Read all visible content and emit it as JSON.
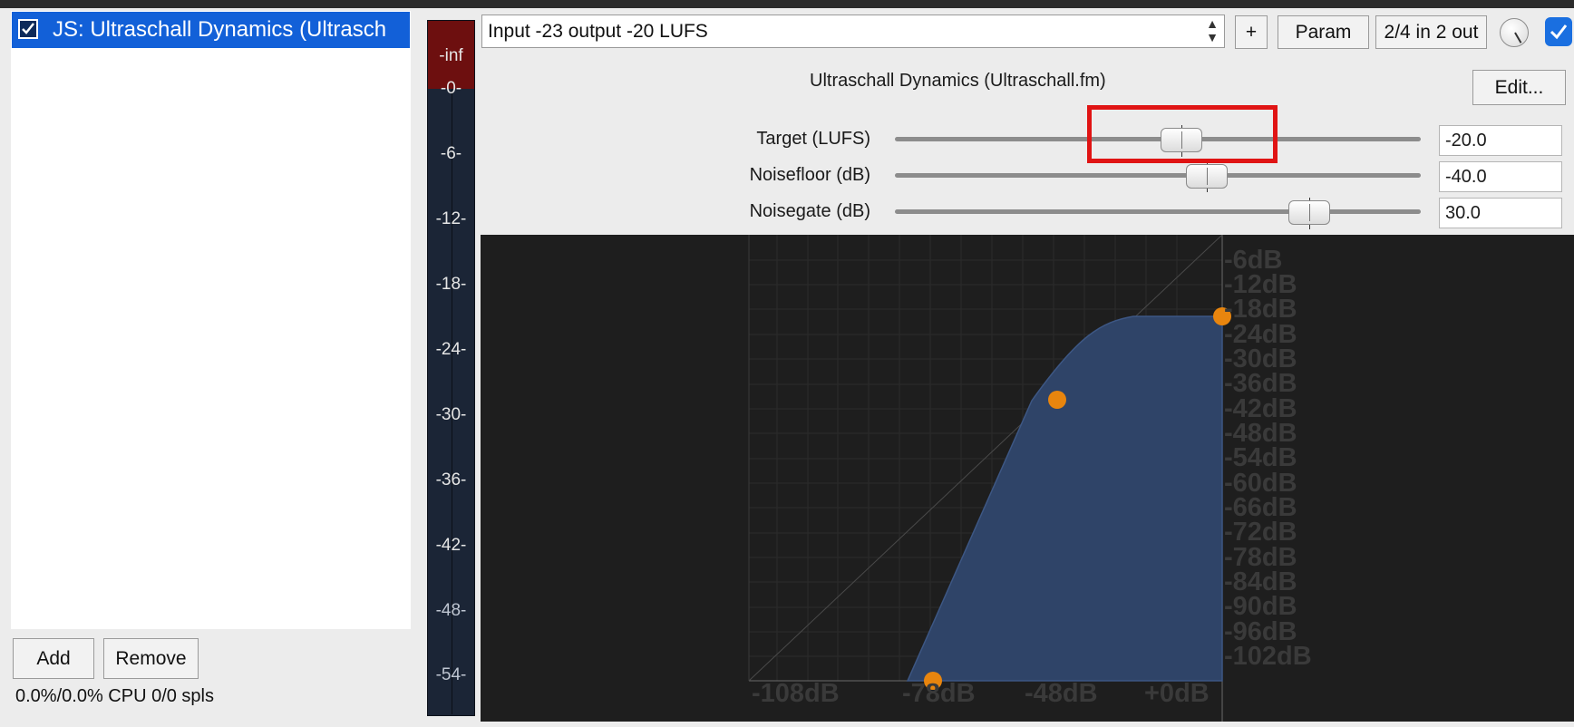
{
  "fx_list": {
    "items": [
      {
        "label": "JS: Ultraschall Dynamics (Ultrasch",
        "enabled": true
      }
    ]
  },
  "buttons": {
    "add": "Add",
    "remove": "Remove",
    "plus": "+",
    "param": "Param",
    "io": "2/4 in 2 out",
    "edit": "Edit..."
  },
  "status": "0.0%/0.0% CPU 0/0 spls",
  "meter": {
    "top": "-inf",
    "labels": [
      "-0-",
      "-6-",
      "-12-",
      "-18-",
      "-24-",
      "-30-",
      "-36-",
      "-42-",
      "-48-",
      "-54-"
    ]
  },
  "preset": {
    "value": "Input -23 output -20 LUFS"
  },
  "plugin": {
    "title": "Ultraschall Dynamics (Ultraschall.fm)",
    "sliders": [
      {
        "label": "Target (LUFS)",
        "value": "-20.0"
      },
      {
        "label": "Noisefloor (dB)",
        "value": "-40.0"
      },
      {
        "label": "Noisegate (dB)",
        "value": "30.0"
      }
    ]
  },
  "graph": {
    "y_labels": [
      "-6dB",
      "-12dB",
      "-18dB",
      "-24dB",
      "-30dB",
      "-36dB",
      "-42dB",
      "-48dB",
      "-54dB",
      "-60dB",
      "-66dB",
      "-72dB",
      "-78dB",
      "-84dB",
      "-90dB",
      "-96dB",
      "-102dB"
    ],
    "x_labels": [
      "-108dB",
      "-78dB",
      "-48dB",
      "+0dB"
    ],
    "fill_color": "#2f4468",
    "point_color": "#e8850e"
  },
  "colors": {
    "selection": "#1260d8",
    "meter_clip": "#6d0f0f",
    "highlight": "#e01414"
  }
}
